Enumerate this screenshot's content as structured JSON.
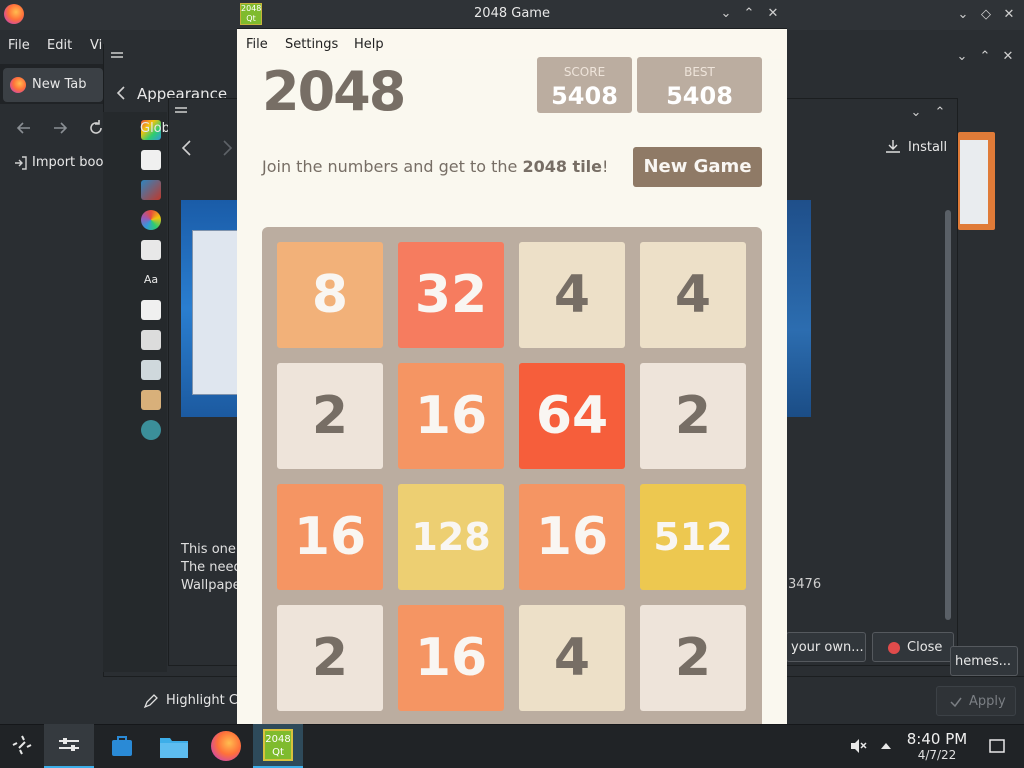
{
  "firefox": {
    "menu": [
      "File",
      "Edit",
      "Vi"
    ],
    "tab_label": "New Tab",
    "import_label": "Import boo"
  },
  "settings": {
    "section_title": "Appearance",
    "glob_label": "Glob",
    "highlight_label": "Highlight Cl",
    "apply_label": "Apply",
    "themes_label": "hemes..."
  },
  "dialog": {
    "install_label": "Install",
    "description": [
      "This one's",
      "The need",
      "Wallpape"
    ],
    "description_tail": "3476",
    "own_label": "your own...",
    "close_label": "Close"
  },
  "game": {
    "window_title": "2048 Game",
    "icon_text": [
      "2048",
      "Qt"
    ],
    "menu": [
      "File",
      "Settings",
      "Help"
    ],
    "logo": "2048",
    "score_label": "SCORE",
    "score": "5408",
    "best_label": "BEST",
    "best": "5408",
    "subtitle_pre": "Join the numbers and get to the ",
    "subtitle_bold": "2048 tile",
    "subtitle_post": "!",
    "new_game_label": "New Game",
    "board": [
      [
        8,
        32,
        4,
        4
      ],
      [
        2,
        16,
        64,
        2
      ],
      [
        16,
        128,
        16,
        512
      ],
      [
        2,
        16,
        4,
        2
      ]
    ],
    "tile_colors": {
      "2": {
        "bg": "#eee4da",
        "fg": "#776e65"
      },
      "4": {
        "bg": "#ede0c8",
        "fg": "#776e65"
      },
      "8": {
        "bg": "#f2b179",
        "fg": "#f9f6f2"
      },
      "16": {
        "bg": "#f59563",
        "fg": "#f9f6f2"
      },
      "32": {
        "bg": "#f67c5f",
        "fg": "#f9f6f2"
      },
      "64": {
        "bg": "#f65e3b",
        "fg": "#f9f6f2"
      },
      "128": {
        "bg": "#edcf72",
        "fg": "#f9f6f2"
      },
      "512": {
        "bg": "#edc850",
        "fg": "#f9f6f2"
      }
    }
  },
  "taskbar": {
    "app_icon_text": [
      "2048",
      "Qt"
    ],
    "time": "8:40 PM",
    "date": "4/7/22"
  }
}
